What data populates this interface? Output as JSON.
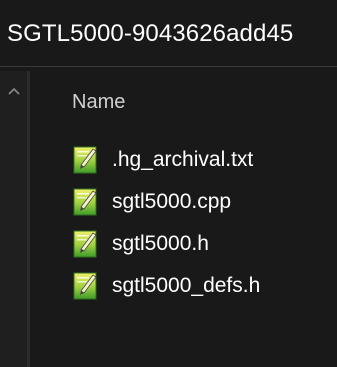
{
  "address_bar": {
    "path": "SGTL5000-9043626add45"
  },
  "file_list": {
    "column_header": "Name",
    "files": [
      {
        "name": ".hg_archival.txt",
        "icon": "notepadpp-file-icon"
      },
      {
        "name": "sgtl5000.cpp",
        "icon": "notepadpp-file-icon"
      },
      {
        "name": "sgtl5000.h",
        "icon": "notepadpp-file-icon"
      },
      {
        "name": "sgtl5000_defs.h",
        "icon": "notepadpp-file-icon"
      }
    ]
  },
  "navigation_pane": {
    "scroll_up_icon": "chevron-up-icon"
  },
  "colors": {
    "background": "#191919",
    "text": "#ffffff",
    "header_text": "#d0d0d0",
    "icon_green": "#5aa62c",
    "icon_yellow": "#e9e33a"
  }
}
